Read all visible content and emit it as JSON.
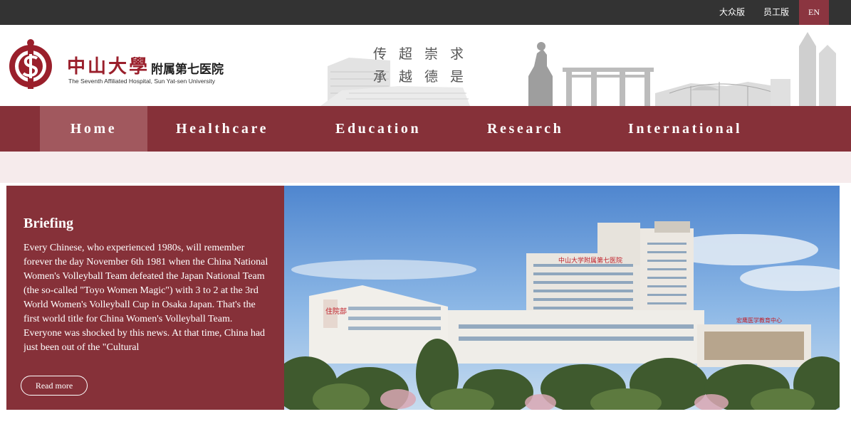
{
  "topbar": {
    "public_label": "大众版",
    "staff_label": "员工版",
    "lang_label": "EN"
  },
  "header": {
    "logo_cn": "中山大學",
    "logo_cn_sub": "附属第七医院",
    "logo_en": "The Seventh Affiliated Hospital, Sun Yat-sen University",
    "motto_line1": "传超崇求",
    "motto_line2": "承越德是",
    "brand_color": "#9a1f2b"
  },
  "nav": {
    "items": [
      {
        "label": "Home",
        "active": true
      },
      {
        "label": "Healthcare"
      },
      {
        "label": "Education"
      },
      {
        "label": "Research"
      },
      {
        "label": "International"
      }
    ],
    "bg_color": "#863139",
    "active_color": "#a1585e"
  },
  "briefing": {
    "title": "Briefing",
    "text": "Every Chinese, who experienced 1980s, will remember forever the day November 6th 1981 when the China National Women's Volleyball Team defeated the Japan National Team (the so-called \"Toyo Women Magic\") with 3 to 2 at the 3rd World Women's Volleyball Cup in Osaka Japan. That's the first world title for China Women's Volleyball Team. Everyone was shocked by this news. At that time, China had just been out of the \"Cultural",
    "read_more_label": "Read more"
  },
  "photo": {
    "sign_top": "中山大学附属第七医院",
    "sign_mid": "住院部",
    "sign_right": "宏鹰医学教育中心"
  }
}
